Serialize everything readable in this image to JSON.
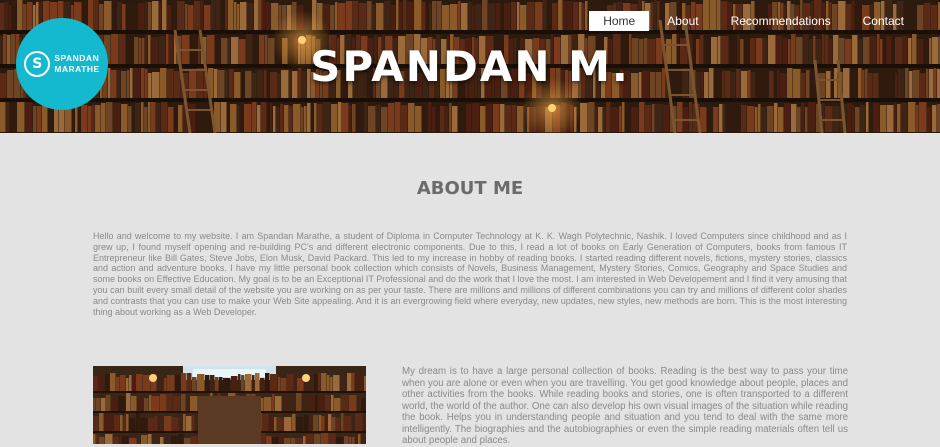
{
  "brand": {
    "logo_letter": "S",
    "logo_line1": "SPANDAN",
    "logo_line2": "MARATHE",
    "site_title": "SPANDAN M.",
    "accent_color": "#14b9cf"
  },
  "nav": {
    "items": [
      {
        "label": "Home",
        "active": true
      },
      {
        "label": "About",
        "active": false
      },
      {
        "label": "Recommendations",
        "active": false
      },
      {
        "label": "Contact",
        "active": false
      }
    ]
  },
  "about": {
    "heading": "ABOUT ME",
    "paragraph": "Hello and welcome to my website. I am Spandan Marathe, a student of Diploma in Computer Technology at K. K. Wagh Polytechnic, Nashik. I loved Computers since childhood and as I grew up, I found myself opening and re-building PC's and different electronic components. Due to this, I read a lot of books on Early Generation of Computers, books from famous IT Entrepreneur like Bill Gates, Steve Jobs, Elon Musk, David Packard. This led to my increase in hobby of reading books. I started reading different novels, fictions, mystery stories, classics and action and adventure books. I have my little personal book collection which consists of Novels, Business Management, Mystery Stories, Comics, Geography and Space Studies and some books on Effective Education. My goal is to be an Exceptional IT Professional and do the work that I love the most. I am interested in Web Developement and I find it very amusing that you can built every small detail of the website you are working on as per your taste. There are millions and millions of different combinations you can try and millions of different color shades and contrasts that you can use to make your Web Site appealing. And it is an evergrowing field where everyday, new updates, new styles, new methods are born. This is the most interesting thing about working as a Web Developer.",
    "dream_paragraph": "My dream is to have a large personal collection of books. Reading is the best way to pass your time when you are alone or even when you are travelling. You get good knowledge about people, places and other activities from the books. While reading books and stories, one is often transported to a different world, the world of the author. One can also develop his own visual images of the situation while reading the book. Helps you in understanding people and situation and you tend to deal with the same more intelligently. The biographies and the autobiographies or even the simple reading materials often tell us about people and places."
  }
}
